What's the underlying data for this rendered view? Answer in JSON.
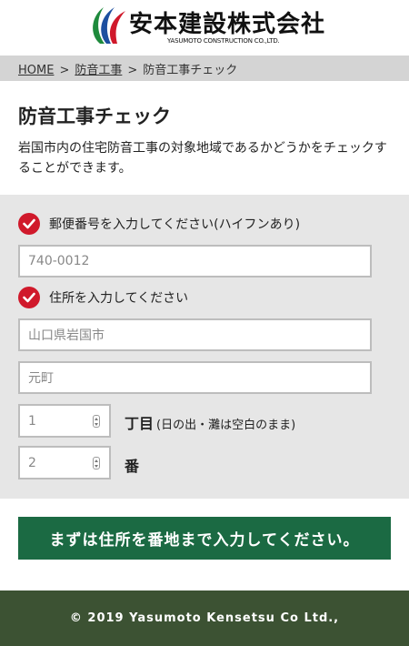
{
  "header": {
    "logo_text": "安本建設株式会社",
    "logo_sub": "YASUMOTO CONSTRUCTION CO.,LTD."
  },
  "breadcrumb": {
    "items": [
      "HOME",
      "防音工事",
      "防音工事チェック"
    ],
    "separator": ">"
  },
  "page": {
    "title": "防音工事チェック",
    "intro": "岩国市内の住宅防音工事の対象地域であるかどうかをチェックすることができます。"
  },
  "form": {
    "postal_label": "郵便番号を入力してください(ハイフンあり)",
    "postal_value": "740-0012",
    "address_label": "住所を入力してください",
    "address_city_value": "山口県岩国市",
    "address_town_value": "元町",
    "chome_value": "1",
    "chome_label": "丁目",
    "chome_note": "(日の出・灘は空白のまま)",
    "ban_value": "2",
    "ban_label": "番"
  },
  "submit": {
    "label": "まずは住所を番地まで入力してください。"
  },
  "footer": {
    "copyright": "© 2019 Yasumoto Kensetsu Co Ltd.,"
  },
  "colors": {
    "check_red": "#d0192b",
    "button_green": "#1b6a43",
    "footer_green": "#3c5233",
    "breadcrumb_gray": "#d4d4d4",
    "form_gray": "#e6e6e6",
    "logo_green": "#1e8a3c",
    "logo_blue": "#1d4fa0",
    "logo_red": "#d0192b"
  },
  "icons": {
    "logo": "stripe-logo-icon",
    "check": "check-circle-icon",
    "spinner": "number-spinner-icon"
  }
}
